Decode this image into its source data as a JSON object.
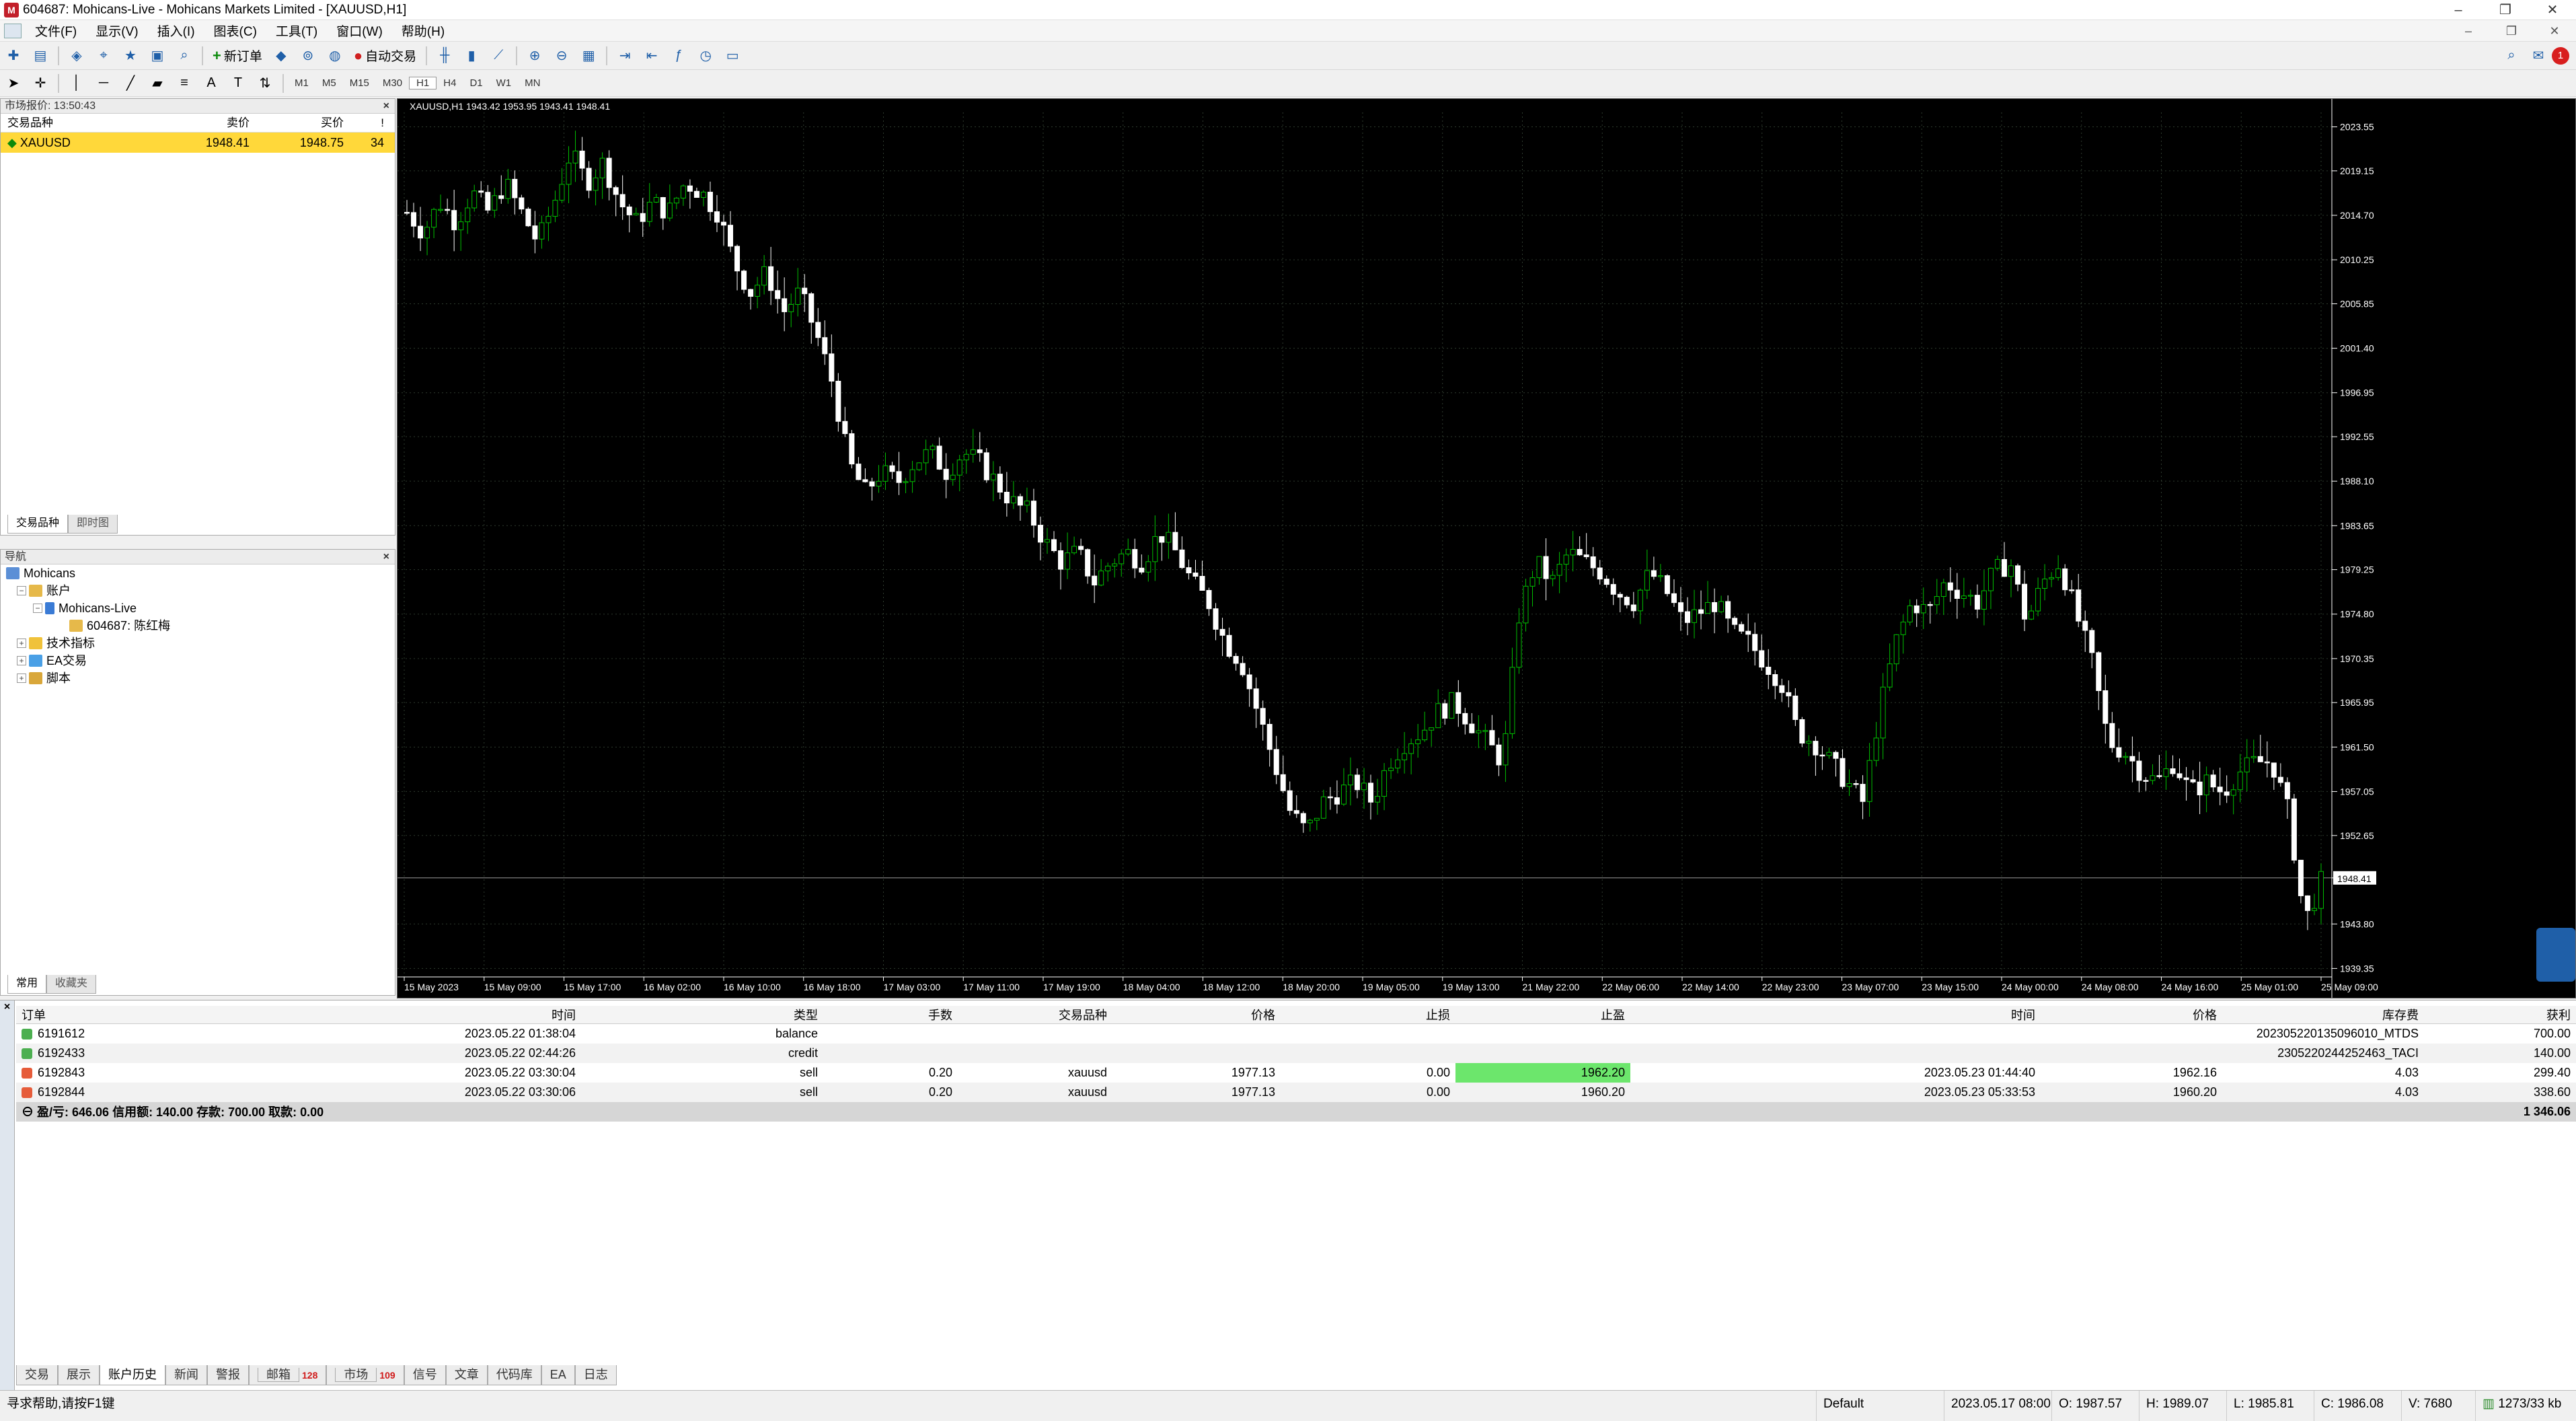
{
  "window": {
    "title": "604687: Mohicans-Live - Mohicans Markets Limited - [XAUUSD,H1]",
    "app_icon": "mt4-icon",
    "min": "–",
    "restore": "❐",
    "close": "✕"
  },
  "menu": [
    "文件(F)",
    "显示(V)",
    "插入(I)",
    "图表(C)",
    "工具(T)",
    "窗口(W)",
    "帮助(H)"
  ],
  "menu_right": [
    "–",
    "❐",
    "✕"
  ],
  "toolbar": {
    "new_order": "新订单",
    "auto_trading": "自动交易",
    "timeframes": [
      "M1",
      "M5",
      "M15",
      "M30",
      "H1",
      "H4",
      "D1",
      "W1",
      "MN"
    ],
    "notification_count": "1",
    "search": "⌕"
  },
  "market_watch": {
    "header": "市场报价: 13:50:43",
    "columns": [
      "交易品种",
      "卖价",
      "买价",
      "!"
    ],
    "rows": [
      {
        "symbol": "XAUUSD",
        "bid": "1948.41",
        "ask": "1948.75",
        "spread": "34"
      }
    ],
    "tabs": [
      "交易品种",
      "即时图"
    ],
    "close": "×"
  },
  "navigator": {
    "header": "导航",
    "close": "×",
    "root": "Mohicans",
    "accounts": "账户",
    "server": "Mohicans-Live",
    "account": "604687: 陈红梅",
    "indicators": "技术指标",
    "experts": "EA交易",
    "scripts": "脚本",
    "tabs": [
      "常用",
      "收藏夹"
    ]
  },
  "chart": {
    "header": "XAUUSD,H1  1943.42 1953.95 1943.41 1948.41",
    "current_price": "1948.41",
    "colors": {
      "bull": "#00c000",
      "bear": "#ffffff",
      "grid": "#2e3b2e",
      "axis": "#ffffff"
    }
  },
  "chart_data": {
    "type": "candlestick",
    "symbol": "XAUUSD",
    "timeframe": "H1",
    "ylim": [
      1938.5,
      2025.0
    ],
    "y_ticks": [
      "2023.55",
      "2019.15",
      "2014.70",
      "2010.25",
      "2005.85",
      "2001.40",
      "1996.95",
      "1992.55",
      "1988.10",
      "1983.65",
      "1979.25",
      "1974.80",
      "1970.35",
      "1965.95",
      "1961.50",
      "1957.05",
      "1952.65",
      "1948.41",
      "1943.80",
      "1939.35"
    ],
    "x_ticks": [
      "15 May 2023",
      "15 May 09:00",
      "15 May 17:00",
      "16 May 02:00",
      "16 May 10:00",
      "16 May 18:00",
      "17 May 03:00",
      "17 May 11:00",
      "17 May 19:00",
      "18 May 04:00",
      "18 May 12:00",
      "18 May 20:00",
      "19 May 05:00",
      "19 May 13:00",
      "21 May 22:00",
      "22 May 06:00",
      "22 May 14:00",
      "22 May 23:00",
      "23 May 07:00",
      "23 May 15:00",
      "24 May 00:00",
      "24 May 08:00",
      "24 May 16:00",
      "25 May 01:00",
      "25 May 09:00"
    ],
    "close_path": [
      2015,
      2013,
      2016,
      2014,
      2017,
      2015,
      2018,
      2015,
      2012,
      2016,
      2021,
      2018,
      2020,
      2016,
      2014,
      2016,
      2015,
      2018,
      2017,
      2015,
      2010,
      2007,
      2009,
      2005,
      2007,
      2003,
      1998,
      1990,
      1987,
      1989,
      1988,
      1990,
      1991,
      1989,
      1991,
      1990,
      1988,
      1986,
      1985,
      1982,
      1980,
      1981,
      1978,
      1980,
      1981,
      1980,
      1983,
      1981,
      1978,
      1976,
      1972,
      1970,
      1965,
      1960,
      1955,
      1953,
      1956,
      1957,
      1958,
      1956,
      1960,
      1962,
      1963,
      1965,
      1966,
      1964,
      1962,
      1960,
      1975,
      1980,
      1978,
      1981,
      1980,
      1979,
      1977,
      1976,
      1979,
      1977,
      1974,
      1975,
      1976,
      1973,
      1972,
      1970,
      1968,
      1963,
      1962,
      1960,
      1958,
      1956,
      1965,
      1972,
      1976,
      1975,
      1978,
      1977,
      1976,
      1979,
      1980,
      1974,
      1978,
      1980,
      1975,
      1970,
      1962,
      1961,
      1959,
      1958,
      1960,
      1957,
      1958,
      1957,
      1959,
      1960,
      1960,
      1955,
      1944,
      1948
    ]
  },
  "terminal": {
    "columns": [
      "订单",
      "时间",
      "类型",
      "手数",
      "交易品种",
      "价格",
      "止损",
      "止盈",
      "时间",
      "价格",
      "库存费",
      "获利"
    ],
    "rows": [
      {
        "order": "6191612",
        "time": "2023.05.22 01:38:04",
        "type": "balance",
        "lots": "",
        "symbol": "",
        "price": "",
        "sl": "",
        "tp": "",
        "close_time": "",
        "close_price": "",
        "swap": "20230522013509​6010_MTDS",
        "profit": "700.00"
      },
      {
        "order": "6192433",
        "time": "2023.05.22 02:44:26",
        "type": "credit",
        "lots": "",
        "symbol": "",
        "price": "",
        "sl": "",
        "tp": "",
        "close_time": "",
        "close_price": "",
        "swap": "23052202442524​63_TACI",
        "profit": "140.00"
      },
      {
        "order": "6192843",
        "time": "2023.05.22 03:30:04",
        "type": "sell",
        "lots": "0.20",
        "symbol": "xauusd",
        "price": "1977.13",
        "sl": "0.00",
        "tp": "1962.20",
        "close_time": "2023.05.23 01:44:40",
        "close_price": "1962.16",
        "swap": "4.03",
        "profit": "299.40"
      },
      {
        "order": "6192844",
        "time": "2023.05.22 03:30:06",
        "type": "sell",
        "lots": "0.20",
        "symbol": "xauusd",
        "price": "1977.13",
        "sl": "0.00",
        "tp": "1960.20",
        "close_time": "2023.05.23 05:33:53",
        "close_price": "1960.20",
        "swap": "4.03",
        "profit": "338.60"
      }
    ],
    "summary": "盈/亏: 646.06  信用额: 140.00  存款: 700.00  取款: 0.00",
    "summary_total": "1 346.06",
    "tabs": [
      "交易",
      "展示",
      "账户历史",
      "新闻",
      "警报",
      "邮箱",
      "市场",
      "信号",
      "文章",
      "代码库",
      "EA",
      "日志"
    ],
    "mail_count": "128",
    "market_count": "109",
    "close": "×"
  },
  "status": {
    "help": "寻求帮助,请按F1键",
    "profile": "Default",
    "datetime": "2023.05.17 08:00",
    "open": "O: 1987.57",
    "high": "H: 1989.07",
    "low": "L: 1985.81",
    "close": "C: 1986.08",
    "volume": "V: 7680",
    "traffic": "1273/33 kb"
  }
}
